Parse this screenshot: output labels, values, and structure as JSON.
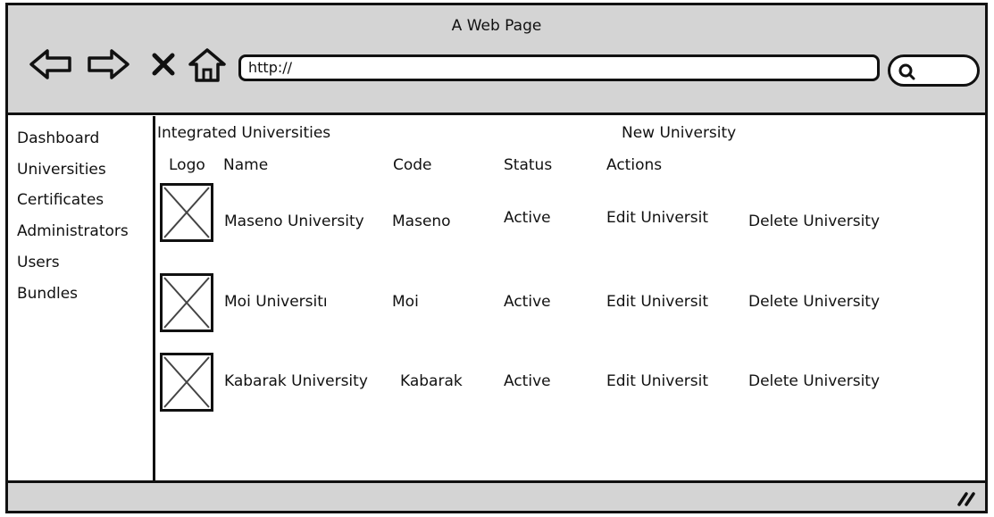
{
  "window": {
    "title": "A Web Page"
  },
  "nav_icons": [
    "back-arrow-icon",
    "forward-arrow-icon",
    "close-x-icon",
    "home-icon",
    "search-icon",
    "resize-grip-icon"
  ],
  "address_bar": {
    "value": "http://"
  },
  "sidebar": {
    "items": [
      {
        "label": "Dashboard"
      },
      {
        "label": "Universities"
      },
      {
        "label": "Certificates"
      },
      {
        "label": "Administrators"
      },
      {
        "label": "Users"
      },
      {
        "label": "Bundles"
      }
    ]
  },
  "main": {
    "title": "Integrated Universities",
    "new_link": "New University",
    "columns": [
      "Logo",
      "Name",
      "Code",
      "Status",
      "Actions"
    ],
    "rows": [
      {
        "name": "Maseno University",
        "code": "Maseno",
        "status": "Active",
        "edit": "Edit Universit",
        "delete": "Delete University"
      },
      {
        "name": "Moi Universitı",
        "code": "Moi",
        "status": "Active",
        "edit": "Edit Universit",
        "delete": "Delete University"
      },
      {
        "name": "Kabarak University",
        "code": "Kabarak",
        "status": "Active",
        "edit": "Edit Universit",
        "delete": "Delete University"
      }
    ]
  },
  "colors": {
    "chrome": "#d4d4d4",
    "border": "#111111",
    "background": "#ffffff"
  }
}
